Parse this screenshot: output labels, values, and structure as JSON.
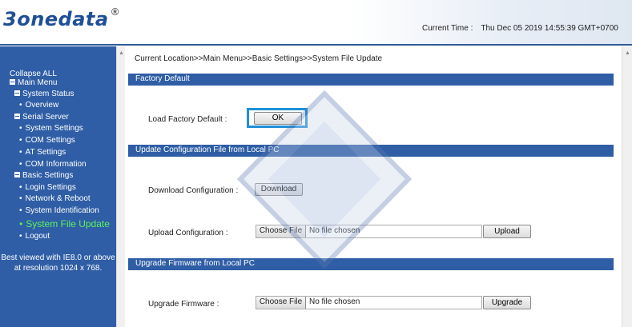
{
  "header": {
    "logo_text": "3onedata",
    "logo_mark": "®",
    "time_label": "Current Time :",
    "time_value": "Thu Dec 05 2019 14:55:39 GMT+0700"
  },
  "sidebar": {
    "items": [
      {
        "label": "Collapse ALL",
        "type": "plain"
      },
      {
        "label": "Main Menu",
        "type": "folder"
      },
      {
        "label": "System Status",
        "type": "folder"
      },
      {
        "label": "Overview",
        "type": "leaf"
      },
      {
        "label": "Serial Server",
        "type": "folder"
      },
      {
        "label": "System Settings",
        "type": "leaf"
      },
      {
        "label": "COM Settings",
        "type": "leaf"
      },
      {
        "label": "AT Settings",
        "type": "leaf"
      },
      {
        "label": "COM Information",
        "type": "leaf"
      },
      {
        "label": "Basic Settings",
        "type": "folder"
      },
      {
        "label": "Login Settings",
        "type": "leaf"
      },
      {
        "label": "Network & Reboot",
        "type": "leaf"
      },
      {
        "label": "System Identification",
        "type": "leaf"
      },
      {
        "label": "System File Update",
        "type": "leaf",
        "active": true
      },
      {
        "label": "Logout",
        "type": "leaf"
      }
    ],
    "best_viewed_line1": "Best viewed with IE8.0 or above",
    "best_viewed_line2": "at resolution 1024 x 768.",
    "bullet": "•"
  },
  "main": {
    "breadcrumb": "Current Location>>Main Menu>>Basic Settings>>System File Update",
    "factory": {
      "title": "Factory Default",
      "load_label": "Load Factory Default :",
      "ok_label": "OK"
    },
    "config": {
      "title": "Update Configuration File from Local PC",
      "download_label": "Download Configuration :",
      "download_button": "Download",
      "upload_label": "Upload Configuration :",
      "choose_file": "Choose File",
      "no_file": "No file chosen",
      "upload_button": "Upload"
    },
    "firmware": {
      "title": "Upgrade Firmware from Local PC",
      "upgrade_label": "Upgrade Firmware :",
      "choose_file": "Choose File",
      "no_file": "No file chosen",
      "upgrade_button": "Upgrade"
    }
  },
  "colors": {
    "accent": "#2f5ea6",
    "active_nav": "#5cf05c",
    "highlight_border": "#1e8fd8"
  }
}
